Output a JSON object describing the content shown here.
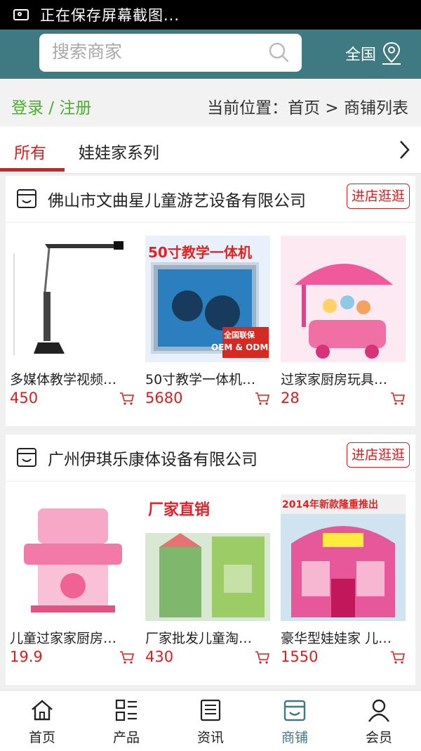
{
  "status_bar": {
    "text": "正在保存屏幕截图..."
  },
  "search": {
    "placeholder": "搜索商家",
    "region": "全国"
  },
  "breadcrumb": {
    "login": "登录 / 注册",
    "location": "当前位置：首页 > 商铺列表"
  },
  "tabs": [
    {
      "label": "所有"
    },
    {
      "label": "娃娃家系列"
    }
  ],
  "shops": [
    {
      "name": "佛山市文曲星儿童游艺设备有限公司",
      "enter_label": "进店逛逛",
      "products": [
        {
          "title": "多媒体教学视频…",
          "price": "450"
        },
        {
          "title": "50寸教学一体机…",
          "price": "5680",
          "banner": "50寸教学一体机",
          "badge": "全国联保",
          "badge2": "OEM & ODM"
        },
        {
          "title": "过家家厨房玩具…",
          "price": "28"
        }
      ]
    },
    {
      "name": "广州伊琪乐康体设备有限公司",
      "enter_label": "进店逛逛",
      "products": [
        {
          "title": "儿童过家家厨房…",
          "price": "19.9"
        },
        {
          "title": "厂家批发儿童淘…",
          "price": "430",
          "banner": "厂家直销"
        },
        {
          "title": "豪华型娃娃家 儿…",
          "price": "1550",
          "banner": "2014年新款隆重推出"
        }
      ]
    }
  ],
  "tabbar": [
    {
      "label": "首页",
      "icon": "home-icon"
    },
    {
      "label": "产品",
      "icon": "grid-list-icon"
    },
    {
      "label": "资讯",
      "icon": "news-icon"
    },
    {
      "label": "商铺",
      "icon": "store-icon",
      "active": true
    },
    {
      "label": "会员",
      "icon": "user-icon"
    }
  ],
  "colors": {
    "header": "#3f7a83",
    "accent": "#d81e1e",
    "login": "#4caf2a"
  }
}
